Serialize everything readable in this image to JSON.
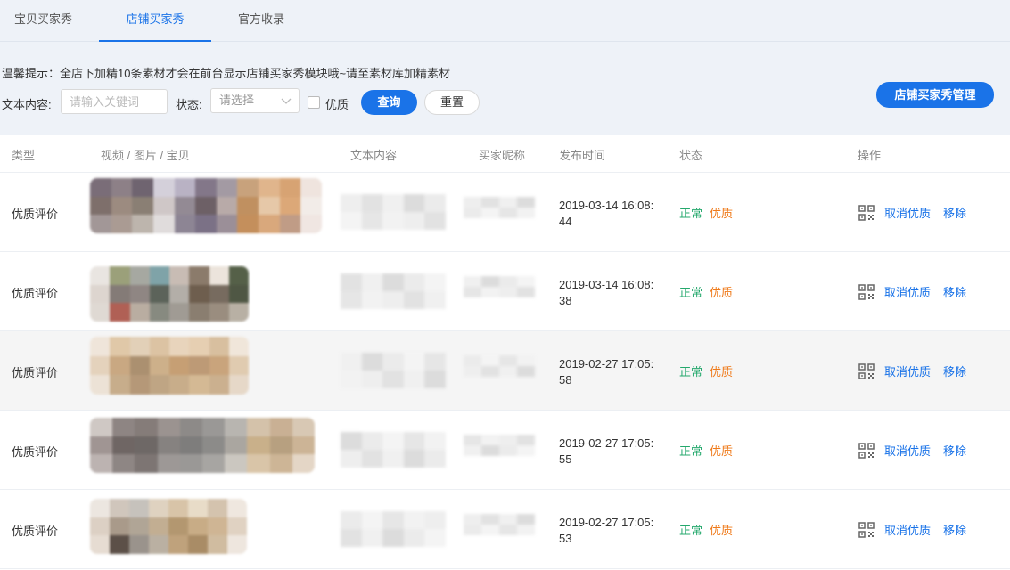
{
  "tabs": [
    {
      "label": "宝贝买家秀",
      "active": false
    },
    {
      "label": "店铺买家秀",
      "active": true
    },
    {
      "label": "官方收录",
      "active": false
    }
  ],
  "tip": "温馨提示：全店下加精10条素材才会在前台显示店铺买家秀模块哦~请至素材库加精素材",
  "filter": {
    "text_label": "文本内容:",
    "text_placeholder": "请输入关键词",
    "status_label": "状态:",
    "status_placeholder": "请选择",
    "quality_label": "优质",
    "query_label": "查询",
    "reset_label": "重置"
  },
  "manage_button": "店铺买家秀管理",
  "table": {
    "headers": [
      "类型",
      "视频 / 图片 / 宝贝",
      "文本内容",
      "买家昵称",
      "发布时间",
      "状态",
      "操作"
    ],
    "rows": [
      {
        "type": "优质评价",
        "time_line1": "2019-03-14 16:08:",
        "time_line2": "44",
        "status": "正常",
        "quality": "优质",
        "action_cancel": "取消优质",
        "action_remove": "移除"
      },
      {
        "type": "优质评价",
        "time_line1": "2019-03-14 16:08:",
        "time_line2": "38",
        "status": "正常",
        "quality": "优质",
        "action_cancel": "取消优质",
        "action_remove": "移除"
      },
      {
        "type": "优质评价",
        "time_line1": "2019-02-27 17:05:",
        "time_line2": "58",
        "status": "正常",
        "quality": "优质",
        "action_cancel": "取消优质",
        "action_remove": "移除"
      },
      {
        "type": "优质评价",
        "time_line1": "2019-02-27 17:05:",
        "time_line2": "55",
        "status": "正常",
        "quality": "优质",
        "action_cancel": "取消优质",
        "action_remove": "移除"
      },
      {
        "type": "优质评价",
        "time_line1": "2019-02-27 17:05:",
        "time_line2": "53",
        "status": "正常",
        "quality": "优质",
        "action_cancel": "取消优质",
        "action_remove": "移除"
      }
    ]
  },
  "colors": {
    "accent": "#1a73e8",
    "status_normal": "#24a86c",
    "status_quality": "#ef7a1a",
    "header_bg": "#eef2f8",
    "highlight_row": "#f5f5f5"
  },
  "icons": {
    "qr": "qr-code-icon",
    "chevron": "chevron-down-icon"
  }
}
